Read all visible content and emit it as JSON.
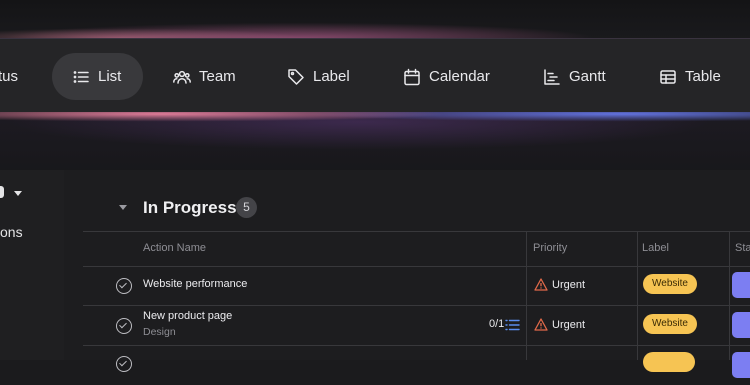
{
  "views": {
    "tabs": [
      {
        "label": "tus",
        "icon": "status-icon",
        "active": false
      },
      {
        "label": "List",
        "icon": "list-icon",
        "active": true
      },
      {
        "label": "Team",
        "icon": "team-icon",
        "active": false
      },
      {
        "label": "Label",
        "icon": "tag-icon",
        "active": false
      },
      {
        "label": "Calendar",
        "icon": "calendar-icon",
        "active": false
      },
      {
        "label": "Gantt",
        "icon": "gantt-icon",
        "active": false
      },
      {
        "label": "Table",
        "icon": "table-icon",
        "active": false
      }
    ]
  },
  "sidebar": {
    "item_label": "ons"
  },
  "group": {
    "title": "In Progress",
    "count": "5"
  },
  "columns": {
    "name": "Action Name",
    "priority": "Priority",
    "label": "Label",
    "status": "Sta"
  },
  "rows": [
    {
      "name": "Website performance",
      "sub": "",
      "subtasks": "",
      "priority": "Urgent",
      "label": "Website"
    },
    {
      "name": "New product page",
      "sub": "Design",
      "subtasks": "0/1",
      "priority": "Urgent",
      "label": "Website"
    },
    {
      "name": "",
      "sub": "",
      "subtasks": "",
      "priority": "",
      "label": ""
    }
  ],
  "colors": {
    "accent": "#7c7ef2",
    "label_bg": "#f6c453",
    "urgent": "#e26a4a"
  }
}
